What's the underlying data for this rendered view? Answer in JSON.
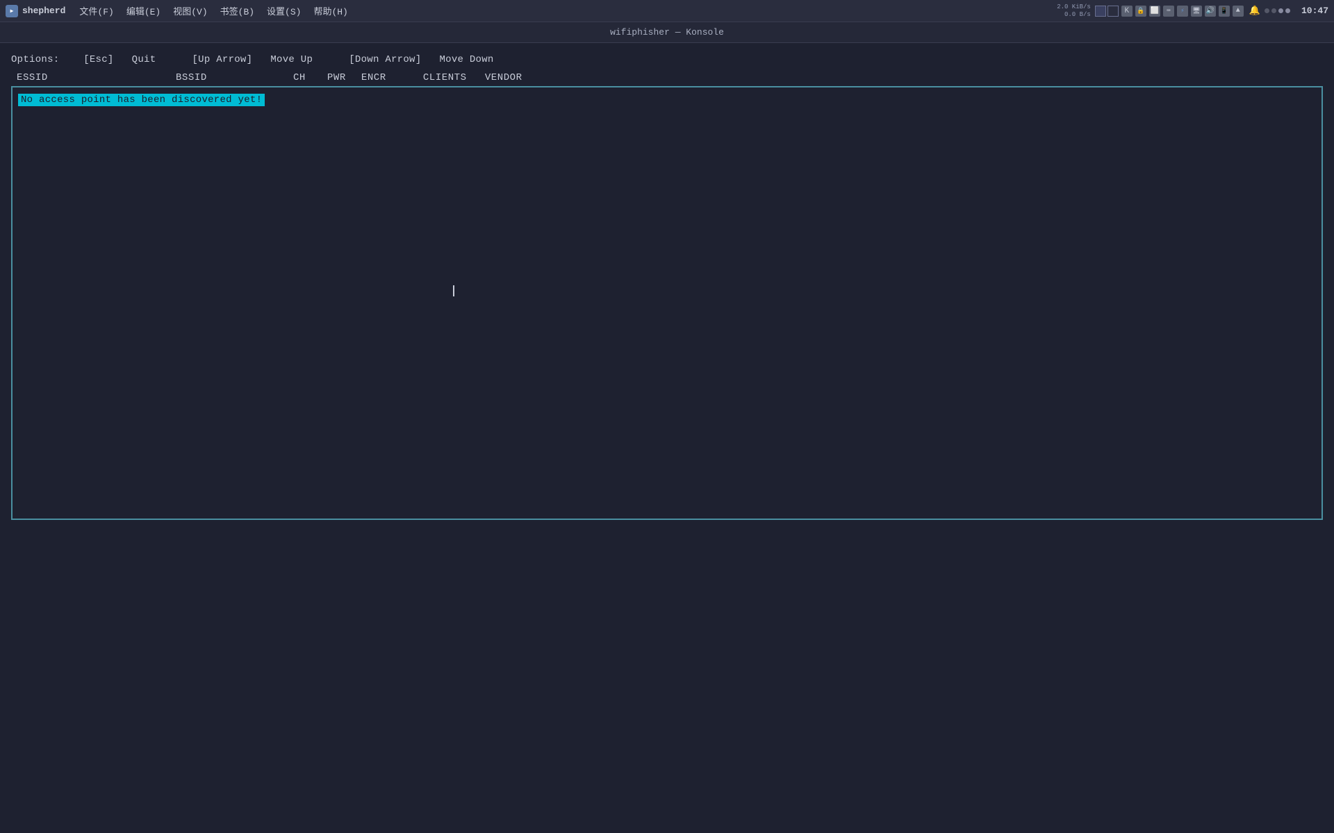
{
  "menubar": {
    "app_name": "shepherd",
    "menus": [
      {
        "label": "文件(F)",
        "id": "file-menu"
      },
      {
        "label": "编辑(E)",
        "id": "edit-menu"
      },
      {
        "label": "视图(V)",
        "id": "view-menu"
      },
      {
        "label": "书签(B)",
        "id": "bookmarks-menu"
      },
      {
        "label": "设置(S)",
        "id": "settings-menu"
      },
      {
        "label": "帮助(H)",
        "id": "help-menu"
      }
    ]
  },
  "window_title": "wifiphisher — Konsole",
  "tray": {
    "network_up": "2.0 KiB/s",
    "network_down": "0.0 B/s",
    "time": "10:47",
    "dots": [
      "gray",
      "gray",
      "light",
      "light"
    ]
  },
  "terminal": {
    "options_label": "Options:",
    "options": [
      {
        "keys": "[Esc]",
        "action": "Quit"
      },
      {
        "keys": "[Up Arrow]",
        "action": "Move Up"
      },
      {
        "keys": "[Down Arrow]",
        "action": "Move Down"
      }
    ],
    "columns": {
      "headers": [
        "ESSID",
        "BSSID",
        "CH",
        "PWR",
        "ENCR",
        "CLIENTS",
        "VENDOR"
      ]
    },
    "message": "No access point has been discovered yet!"
  },
  "colors": {
    "background": "#1e2130",
    "menubar_bg": "#2a2d3e",
    "terminal_border": "#4a8fa0",
    "highlight_bg": "#00bcd4",
    "highlight_fg": "#1a1d2a",
    "text_primary": "#c8ccd8",
    "text_secondary": "#9098b0"
  }
}
